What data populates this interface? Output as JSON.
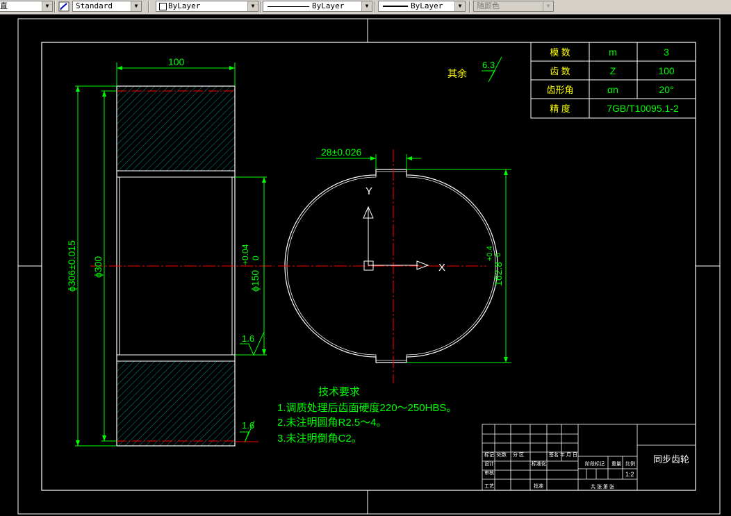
{
  "toolbar": {
    "text_style_combo": {
      "value": "Standard"
    },
    "layer_combo": {
      "value": "ByLayer"
    },
    "linetype_combo": {
      "value": "ByLayer"
    },
    "lineweight_combo": {
      "value": "ByLayer"
    },
    "plotstyle_combo": {
      "value": "随颜色"
    },
    "left_partial_label": "直"
  },
  "drawing": {
    "roughness_note": {
      "prefix": "其余",
      "value": "6.3"
    },
    "roughness_bore": "1.6",
    "roughness_face": "1.6",
    "dims": {
      "width": "100",
      "outer_dia": "ϕ306±0.015",
      "pitch_dia": "ϕ300",
      "bore_dia": "ϕ150",
      "bore_tol_upper": "+0.04",
      "bore_tol_lower": "0",
      "keyway_width": "28±0.026",
      "keyway_depth": "162.8",
      "keyway_tol_upper": "+0.4",
      "keyway_tol_lower": "0"
    },
    "ucs": {
      "y": "Y",
      "x": "X"
    },
    "gear_params": [
      {
        "name": "模 数",
        "symbol": "m",
        "value": "3"
      },
      {
        "name": "齿 数",
        "symbol": "Z",
        "value": "100"
      },
      {
        "name": "齿形角",
        "symbol": "αn",
        "value": "20°"
      },
      {
        "name": "精 度",
        "symbol": "",
        "value": "7GB/T10095.1-2"
      }
    ],
    "tech_requirements": {
      "title": "技术要求",
      "items": [
        "1.调质处理后齿面硬度220～250HBS。",
        "2.未注明圆角R2.5～4。",
        "3.未注明倒角C2。"
      ]
    },
    "title_block": {
      "part_name": "同步齿轮",
      "scale": "1:2",
      "row_labels": [
        "标记",
        "处数",
        "分 区"
      ],
      "sign_labels": [
        "设计",
        "审核",
        "工艺"
      ],
      "std_label": "标准化",
      "approve_label": "批准",
      "sign_date_label": "签名 年 月 日",
      "stage_label": "阶段标记",
      "weight_label": "重量",
      "scale_label": "比例",
      "sheet_label": "共 张  第 张"
    }
  },
  "colors": {
    "green": "#00ff00",
    "red": "#ff0000",
    "cyan": "#00c8c8",
    "white": "#ffffff",
    "yellow": "#ffff00",
    "toolbar": "#d4d0c8"
  }
}
